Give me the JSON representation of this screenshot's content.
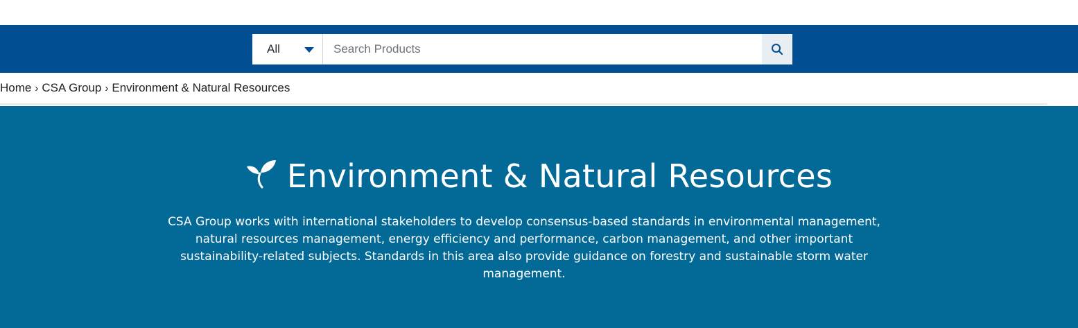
{
  "search": {
    "category_selected": "All",
    "placeholder": "Search Products",
    "value": ""
  },
  "breadcrumb": {
    "items": [
      "Home",
      "CSA Group",
      "Environment & Natural Resources"
    ]
  },
  "hero": {
    "title": "Environment & Natural Resources",
    "description": "CSA Group works with international stakeholders to develop consensus-based standards in environmental management, natural resources management, energy efficiency and performance, carbon management, and other important sustainability-related subjects. Standards in this area also provide guidance on forestry and sustainable storm water management.",
    "icon": "sprout-icon"
  },
  "colors": {
    "search_bar_bg": "#014f92",
    "hero_bg": "#036a97",
    "accent": "#014f92"
  }
}
